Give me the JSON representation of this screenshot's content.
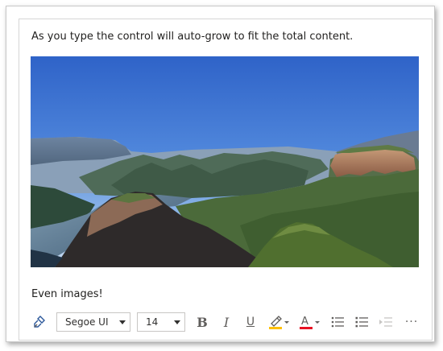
{
  "editor": {
    "top_text": "As you type the control will auto-grow to fit the total content.",
    "bottom_text": "Even images!",
    "image_alt": "landscape-photo"
  },
  "toolbar": {
    "font_family": "Segoe UI",
    "font_size": "14",
    "bold_label": "B",
    "italic_label": "I",
    "underline_label": "U",
    "font_color_label": "A",
    "more_label": "···",
    "colors": {
      "highlight": "#ffc000",
      "font_color": "#e81123",
      "icon": "#605e5c",
      "disabled": "#c8c6c4"
    }
  },
  "icons": {
    "format_painter": "format-painter-icon",
    "highlight": "highlighter-icon",
    "bullets": "bullet-list-icon",
    "numbered": "numbered-list-icon",
    "indent": "increase-indent-icon",
    "more": "more-icon"
  }
}
